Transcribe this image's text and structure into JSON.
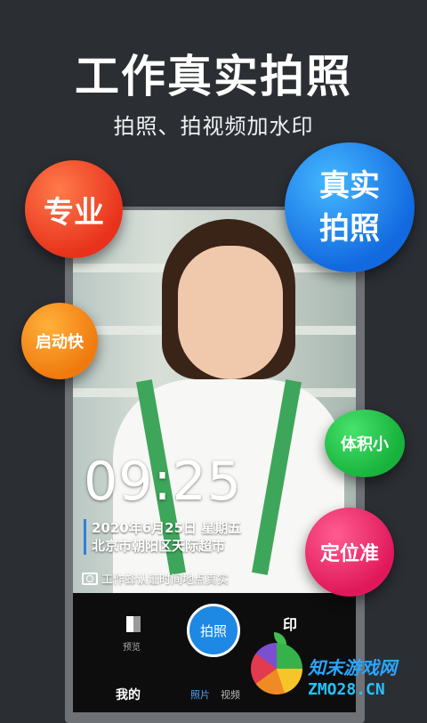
{
  "headline": "工作真实拍照",
  "subline": "拍照、拍视频加水印",
  "bubbles": {
    "pro": "专业",
    "real_line1": "真实",
    "real_line2": "拍照",
    "fast": "启动快",
    "small": "体积小",
    "location": "定位准"
  },
  "camera": {
    "time": "09:25",
    "date": "2020年6月25日 星期五",
    "location": "北京市朝阳区天际超市",
    "verify": "工作蜂认证时间地点真实"
  },
  "controls": {
    "preview_label": "预览",
    "shutter_label": "拍照",
    "watermark_label": "印",
    "tab_mine": "我的",
    "tab_photo": "照片",
    "tab_video": "视频"
  },
  "logo": {
    "name": "知末游戏网",
    "domain": "ZMO28.CN"
  },
  "colors": {
    "background": "#2b2e33",
    "shutter": "#1e88e5",
    "stamp_bar": "#2f7de0",
    "active_tab": "#4aa3ff"
  }
}
